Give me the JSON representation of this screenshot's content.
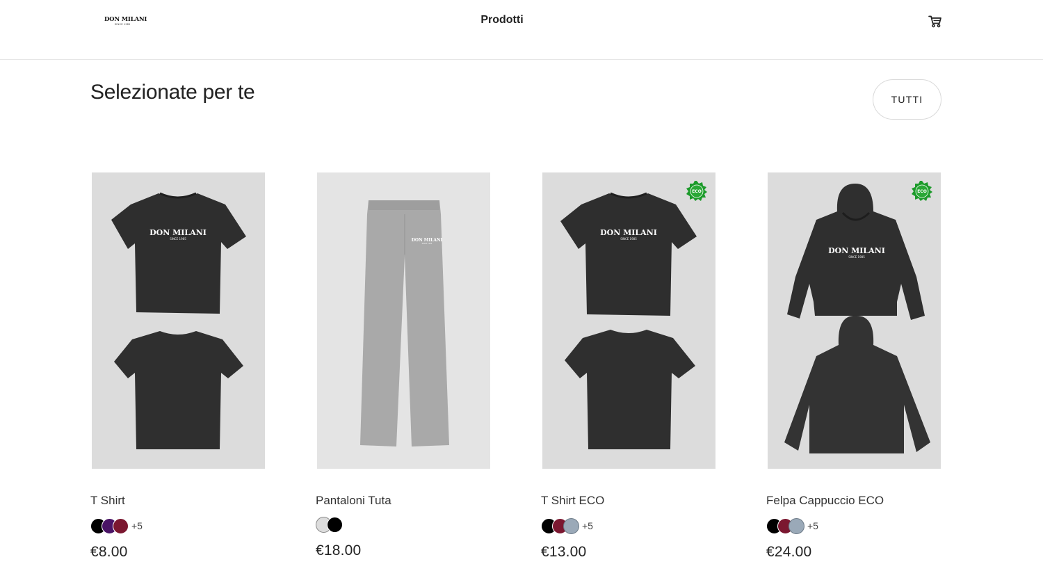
{
  "header": {
    "logo_text": "DON MILANI",
    "logo_subtext": "SINCE 1985",
    "nav_title": "Prodotti",
    "cart_icon": "cart-icon"
  },
  "section": {
    "title": "Selezionate per te",
    "all_button_label": "TUTTI"
  },
  "products": [
    {
      "name": "T Shirt",
      "price": "€8.00",
      "image_text": "DON MILANI",
      "image_subtext": "SINCE 1985",
      "swatches": [
        "#000000",
        "#4a1466",
        "#7b1730"
      ],
      "more_colors": "+5",
      "eco": false
    },
    {
      "name": "Pantaloni Tuta",
      "price": "€18.00",
      "image_text": "DON MILANI",
      "image_subtext": "SINCE 1985",
      "swatches": [
        "#dcdcdc",
        "#000000"
      ],
      "more_colors": "",
      "eco": false
    },
    {
      "name": "T Shirt ECO",
      "price": "€13.00",
      "image_text": "DON MILANI",
      "image_subtext": "SINCE 1985",
      "swatches": [
        "#000000",
        "#7b1730",
        "#9aa9b8"
      ],
      "more_colors": "+5",
      "eco": true,
      "eco_badge_text": "ECO"
    },
    {
      "name": "Felpa Cappuccio ECO",
      "price": "€24.00",
      "image_text": "DON MILANI",
      "image_subtext": "SINCE 1985",
      "swatches": [
        "#000000",
        "#7b1730",
        "#9aa9b8"
      ],
      "more_colors": "+5",
      "eco": true,
      "eco_badge_text": "ECO"
    }
  ],
  "colors": {
    "garment_dark": "#2e2e2e",
    "garment_grey": "#a9a9a9",
    "image_background": "#dcdcdc",
    "eco_green": "#1c9a2a"
  }
}
